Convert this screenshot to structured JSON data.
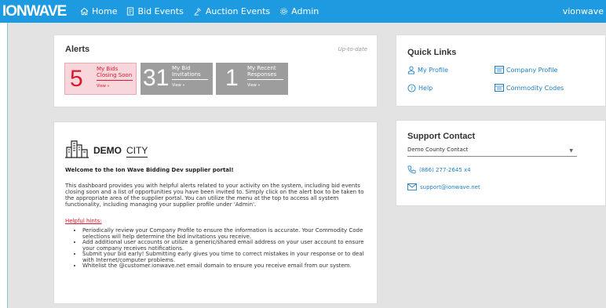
{
  "header": {
    "logo": "IONWAVE",
    "nav": [
      {
        "label": "Home",
        "icon": "home-icon"
      },
      {
        "label": "Bid Events",
        "icon": "document-icon"
      },
      {
        "label": "Auction Events",
        "icon": "gavel-icon"
      },
      {
        "label": "Admin",
        "icon": "gear-icon"
      }
    ],
    "user": "vionwave",
    "bar_color": "#1e9be0"
  },
  "alerts": {
    "title": "Alerts",
    "status": "Up-to-date",
    "tiles": [
      {
        "count": "5",
        "label_line1": "My Bids",
        "label_line2": "Closing Soon",
        "link": "View »",
        "color": "#d9192d"
      },
      {
        "count": "31",
        "label_line1": "My Bid",
        "label_line2": "Invitations",
        "link": "View »",
        "color": "#9d9d9d"
      },
      {
        "count": "1",
        "label_line1": "My Recent",
        "label_line2": "Responses",
        "link": "View »",
        "color": "#9d9d9d"
      }
    ]
  },
  "welcome": {
    "logo_bold": "DEMO",
    "logo_light": "CITY",
    "title": "Welcome to the Ion Wave Bidding Dev supplier portal!",
    "body": "This dashboard provides you with helpful alerts related to your activity on the system, including bid events closing soon and a list of opportunities you have been invited to. Simply click on the alert box to be taken to the appropriate area of the supplier portal. You can utilize the menu at the top to access all system functionality, including managing your supplier profile under 'Admin'.",
    "hints_title": "Helpful hints:",
    "hints": [
      "Periodically review your Company Profile to ensure the information is accurate. Your Commodity Code selections will help determine the bid invitations you receive.",
      "Add additional user accounts or utilize a generic/shared email address on your user account to ensure your company receives notifications.",
      "Submit your bid early! Submitting early gives you time to correct mistakes in your response or to deal with Internet/computer problems.",
      "Whitelist the @customer.ionwave.net email domain to ensure you receive email from our system."
    ]
  },
  "quick_links": {
    "title": "Quick Links",
    "items": [
      {
        "label": "My Profile",
        "icon": "user-icon"
      },
      {
        "label": "Company Profile",
        "icon": "building-icon"
      },
      {
        "label": "Help",
        "icon": "help-icon"
      },
      {
        "label": "Commodity Codes",
        "icon": "building-icon"
      }
    ]
  },
  "support": {
    "title": "Support Contact",
    "selected_contact": "Demo County Contact",
    "phone": "(866) 277-2645 x4",
    "email": "support@ionwave.net"
  }
}
